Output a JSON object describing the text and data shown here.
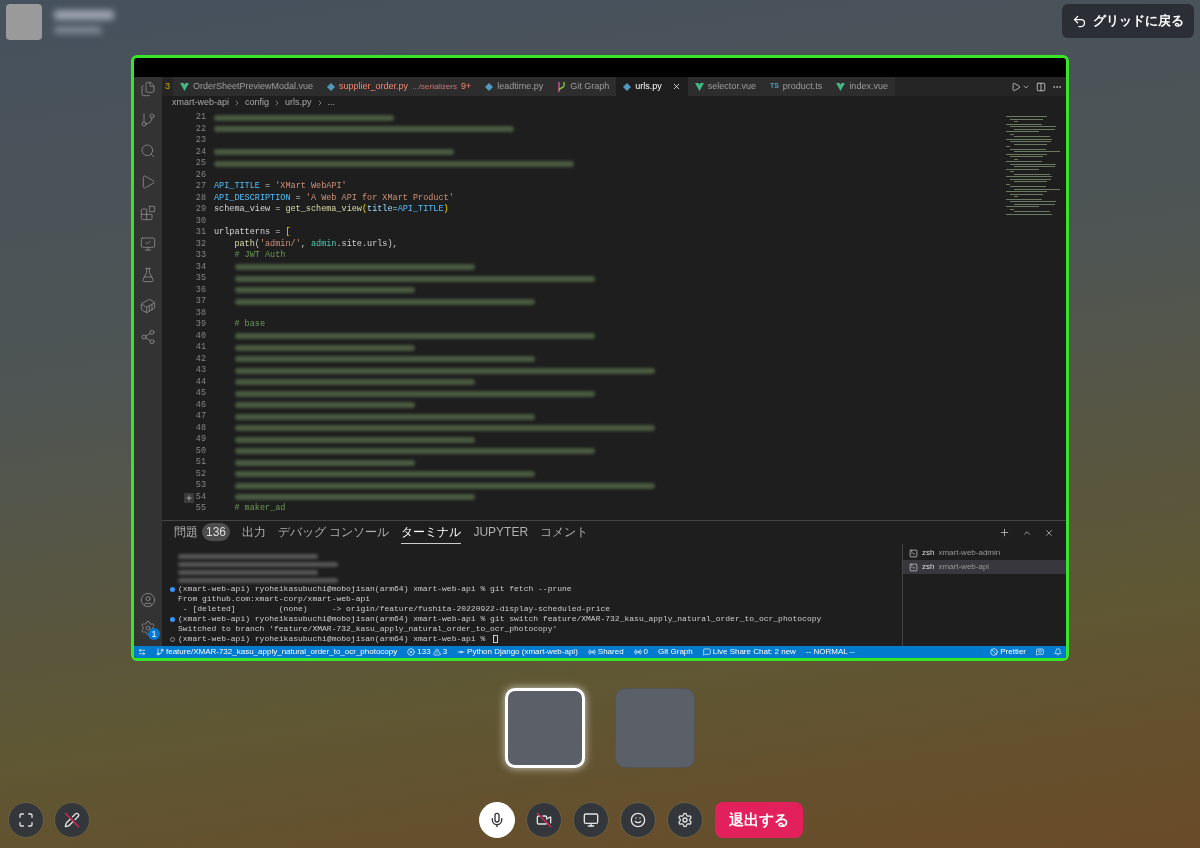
{
  "header": {
    "back_button": "グリッドに戻る"
  },
  "shared_screen": {
    "tabs_overflow": "3",
    "tabs": [
      {
        "kind": "vue",
        "label": "OrderSheetPreviewModal.vue",
        "selected": false,
        "has_errors": false
      },
      {
        "kind": "py",
        "label": "supplier_order.py",
        "detail": ".../serializers",
        "badge": "9+",
        "selected": false,
        "has_errors": true
      },
      {
        "kind": "py",
        "label": "leadtime.py",
        "selected": false,
        "has_errors": false
      },
      {
        "kind": "git",
        "label": "Git Graph",
        "selected": false,
        "has_errors": false
      },
      {
        "kind": "py",
        "label": "urls.py",
        "selected": true,
        "has_errors": false
      },
      {
        "kind": "vue",
        "label": "selector.vue",
        "selected": false,
        "has_errors": false
      },
      {
        "kind": "ts",
        "icon_text": "TS",
        "label": "product.ts",
        "selected": false,
        "has_errors": false
      },
      {
        "kind": "vue",
        "label": "index.vue",
        "selected": false,
        "has_errors": false
      }
    ],
    "breadcrumb": [
      "xmart-web-api",
      "config",
      "urls.py",
      "..."
    ],
    "code_lines": [
      {
        "number": "21",
        "kind": "blurred"
      },
      {
        "number": "22",
        "kind": "blurred"
      },
      {
        "number": "23",
        "kind": "blank"
      },
      {
        "number": "24",
        "kind": "blurred"
      },
      {
        "number": "25",
        "kind": "blurred"
      },
      {
        "number": "26",
        "kind": "blank"
      },
      {
        "number": "27",
        "kind": "code",
        "tokens": [
          {
            "text": "API_TITLE",
            "kind": "const"
          },
          {
            "text": " = ",
            "kind": "plain"
          },
          {
            "text": "'XMart WebAPI'",
            "kind": "str"
          }
        ]
      },
      {
        "number": "28",
        "kind": "code",
        "tokens": [
          {
            "text": "API_DESCRIPTION",
            "kind": "const"
          },
          {
            "text": " = ",
            "kind": "plain"
          },
          {
            "text": "'A Web API for XMart Product'",
            "kind": "str"
          }
        ]
      },
      {
        "number": "29",
        "kind": "code",
        "tokens": [
          {
            "text": "schema_view = ",
            "kind": "plain"
          },
          {
            "text": "get_schema_view",
            "kind": "fn"
          },
          {
            "text": "(",
            "kind": "bracket"
          },
          {
            "text": "title=",
            "kind": "param"
          },
          {
            "text": "API_TITLE",
            "kind": "const"
          },
          {
            "text": ")",
            "kind": "bracket"
          }
        ]
      },
      {
        "number": "30",
        "kind": "blank"
      },
      {
        "number": "31",
        "kind": "code",
        "tokens": [
          {
            "text": "urlpatterns = ",
            "kind": "plain"
          },
          {
            "text": "[",
            "kind": "bracket"
          }
        ]
      },
      {
        "number": "32",
        "kind": "code",
        "tokens": [
          {
            "text": "    path",
            "kind": "fn"
          },
          {
            "text": "(",
            "kind": "plain"
          },
          {
            "text": "'admin/'",
            "kind": "str"
          },
          {
            "text": ", ",
            "kind": "plain"
          },
          {
            "text": "admin",
            "kind": "module"
          },
          {
            "text": ".site.urls),",
            "kind": "plain"
          }
        ]
      },
      {
        "number": "33",
        "kind": "code",
        "tokens": [
          {
            "text": "    # JWT Auth",
            "kind": "comment"
          }
        ]
      },
      {
        "number": "34",
        "kind": "blurred"
      },
      {
        "number": "35",
        "kind": "blurred"
      },
      {
        "number": "36",
        "kind": "blurred"
      },
      {
        "number": "37",
        "kind": "blurred"
      },
      {
        "number": "38",
        "kind": "blank"
      },
      {
        "number": "39",
        "kind": "code",
        "tokens": [
          {
            "text": "    # base",
            "kind": "comment"
          }
        ]
      },
      {
        "number": "40",
        "kind": "blurred"
      },
      {
        "number": "41",
        "kind": "blurred"
      },
      {
        "number": "42",
        "kind": "blurred"
      },
      {
        "number": "43",
        "kind": "blurred"
      },
      {
        "number": "44",
        "kind": "blurred"
      },
      {
        "number": "45",
        "kind": "blurred"
      },
      {
        "number": "46",
        "kind": "blurred"
      },
      {
        "number": "47",
        "kind": "blurred"
      },
      {
        "number": "48",
        "kind": "blurred"
      },
      {
        "number": "49",
        "kind": "blurred"
      },
      {
        "number": "50",
        "kind": "blurred"
      },
      {
        "number": "51",
        "kind": "blurred"
      },
      {
        "number": "52",
        "kind": "blurred"
      },
      {
        "number": "53",
        "kind": "blurred"
      },
      {
        "number": "54",
        "kind": "blurred",
        "gutter_plus": true
      },
      {
        "number": "55",
        "kind": "code",
        "tokens": [
          {
            "text": "    # maker_ad",
            "kind": "comment"
          }
        ]
      }
    ],
    "panel_tabs": [
      {
        "label": "問題",
        "badge": "136",
        "selected": false
      },
      {
        "label": "出力",
        "selected": false
      },
      {
        "label": "デバッグ コンソール",
        "selected": false
      },
      {
        "label": "ターミナル",
        "selected": true
      },
      {
        "label": "JUPYTER",
        "selected": false
      },
      {
        "label": "コメント",
        "selected": false
      }
    ],
    "terminal_lines": [
      {
        "kind": "blurred"
      },
      {
        "kind": "blurred"
      },
      {
        "kind": "blurred"
      },
      {
        "kind": "blurred"
      },
      {
        "kind": "prompt",
        "completed": true,
        "text": "(xmart-web-api) ryoheikasubuchi@mobojisan(arm64) xmart-web-api % git fetch --prune"
      },
      {
        "kind": "output",
        "text": "From github.com:xmart-corp/xmart-web-api"
      },
      {
        "kind": "output",
        "text": " - [deleted]         (none)     -> origin/feature/fushita-20220922-display-scheduled-price"
      },
      {
        "kind": "prompt",
        "completed": true,
        "text": "(xmart-web-api) ryoheikasubuchi@mobojisan(arm64) xmart-web-api % git switch feature/XMAR-732_kasu_apply_natural_order_to_ocr_photocopy"
      },
      {
        "kind": "output",
        "text": "Switched to branch 'feature/XMAR-732_kasu_apply_natural_order_to_ocr_photocopy'"
      },
      {
        "kind": "prompt",
        "completed": false,
        "text": "(xmart-web-api) ryoheikasubuchi@mobojisan(arm64) xmart-web-api % ",
        "cursor": true
      }
    ],
    "terminals": [
      {
        "shell": "zsh",
        "name": "xmart-web-admin",
        "selected": false
      },
      {
        "shell": "zsh",
        "name": "xmart-web-api",
        "selected": true
      }
    ],
    "settings_badge": "1",
    "status_bar": {
      "branch": "feature/XMAR-732_kasu_apply_natural_order_to_ocr_photocopy",
      "errors": "133",
      "warnings": "3",
      "interpreter": "Python Django (xmart-web-api)",
      "share": "Shared",
      "ports": "0",
      "git_graph": "Git Graph",
      "chat": "Live Share Chat: 2 new",
      "mode": "-- NORMAL --",
      "formatter": "Prettier"
    }
  },
  "participants": [
    {
      "selected": true
    },
    {
      "selected": false
    }
  ],
  "controls": {
    "drawing_on": false,
    "mic_on": true,
    "camera_on": false,
    "leave_button": "退出する"
  }
}
